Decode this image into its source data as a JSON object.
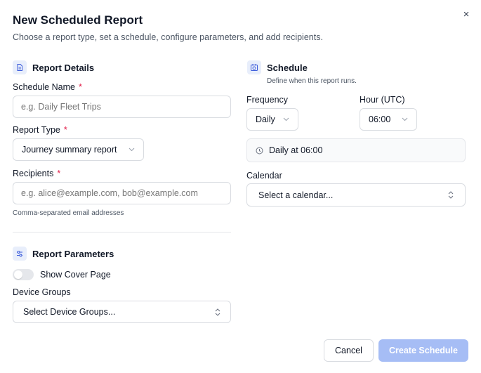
{
  "dialog": {
    "title": "New Scheduled Report",
    "subtitle": "Choose a report type, set a schedule, configure parameters, and add recipients.",
    "close_label": "×"
  },
  "report_details": {
    "heading": "Report Details",
    "schedule_name": {
      "label": "Schedule Name",
      "required_mark": "*",
      "placeholder": "e.g. Daily Fleet Trips",
      "value": ""
    },
    "report_type": {
      "label": "Report Type",
      "required_mark": "*",
      "selected": "Journey summary report"
    },
    "recipients": {
      "label": "Recipients",
      "required_mark": "*",
      "placeholder": "e.g. alice@example.com, bob@example.com",
      "value": "",
      "hint": "Comma-separated email addresses"
    }
  },
  "schedule": {
    "heading": "Schedule",
    "description": "Define when this report runs.",
    "frequency": {
      "label": "Frequency",
      "selected": "Daily"
    },
    "hour": {
      "label": "Hour (UTC)",
      "selected": "06:00"
    },
    "summary": "Daily at 06:00",
    "calendar": {
      "label": "Calendar",
      "placeholder": "Select a calendar..."
    }
  },
  "report_parameters": {
    "heading": "Report Parameters",
    "cover_page": {
      "label": "Show Cover Page",
      "enabled": false
    },
    "device_groups": {
      "label": "Device Groups",
      "placeholder": "Select Device Groups..."
    }
  },
  "footer": {
    "cancel_label": "Cancel",
    "create_label": "Create Schedule"
  },
  "colors": {
    "accent": "#2563eb",
    "primary_disabled": "#a6bdf5",
    "required": "#e11d48",
    "icon_bg": "#e8eefb"
  }
}
